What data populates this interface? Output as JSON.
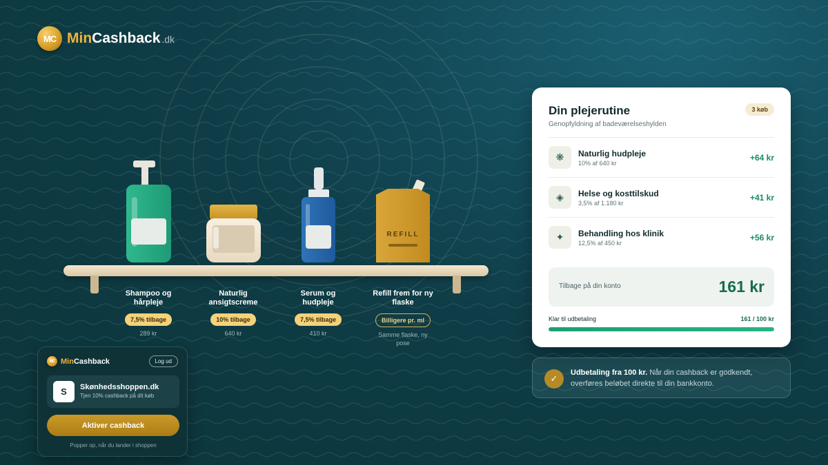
{
  "brand": {
    "min": "Min",
    "cash": "Cashback",
    "tld": ".dk",
    "coin": "MC"
  },
  "colors": {
    "gold": "#d9a12a",
    "green_accent": "#1b8a63",
    "bg_dark": "#0c3539"
  },
  "products": [
    {
      "name": "Shampoo og hårpleje",
      "badge": "7,5% tilbage",
      "price": "289 kr",
      "icon": "pump-bottle-icon"
    },
    {
      "name": "Naturlig ansigtscreme",
      "badge": "10% tilbage",
      "price": "640 kr",
      "icon": "cream-jar-icon"
    },
    {
      "name": "Serum og hudpleje",
      "badge": "7,5% tilbage",
      "price": "410 kr",
      "icon": "serum-bottle-icon"
    },
    {
      "name": "Refill frem for ny flaske",
      "badge": "Billigere pr. ml",
      "price": "Samme flaske, ny pose",
      "icon": "refill-pouch-icon",
      "pouch_label": "REFILL"
    }
  ],
  "popup": {
    "brand_min": "Min",
    "brand_cash": "Cashback",
    "coin": "MC",
    "logout": "Log ud",
    "shop_initial": "S",
    "shop_name": "Skønhedsshoppen.dk",
    "shop_sub": "Tjen 10% cashback på dit køb",
    "activate": "Aktiver cashback",
    "footer": "Popper op, når du lander i shoppen"
  },
  "card": {
    "title": "Din plejerutine",
    "subtitle": "Genopfyldning af badeværelseshylden",
    "count": "3 køb",
    "rows": [
      {
        "icon_glyph": "❋",
        "icon": "flower-icon",
        "title": "Naturlig hudpleje",
        "sub": "10% af 640 kr",
        "amount": "+64 kr"
      },
      {
        "icon_glyph": "◈",
        "icon": "diamond-icon",
        "title": "Helse og kosttilskud",
        "sub": "3,5% af 1.180 kr",
        "amount": "+41 kr"
      },
      {
        "icon_glyph": "✦",
        "icon": "sparkle-icon",
        "title": "Behandling hos klinik",
        "sub": "12,5% af 450 kr",
        "amount": "+56 kr"
      }
    ],
    "total_label": "Tilbage på din konto",
    "total_value": "161 kr",
    "payout_label": "Klar til udbetaling",
    "payout_count": "161 / 100 kr",
    "progress_fraction": 1.0
  },
  "info": {
    "check_glyph": "✓",
    "bold": "Udbetaling fra 100 kr.",
    "text": " Når din cashback er godkendt, overføres beløbet direkte til din bankkonto."
  }
}
